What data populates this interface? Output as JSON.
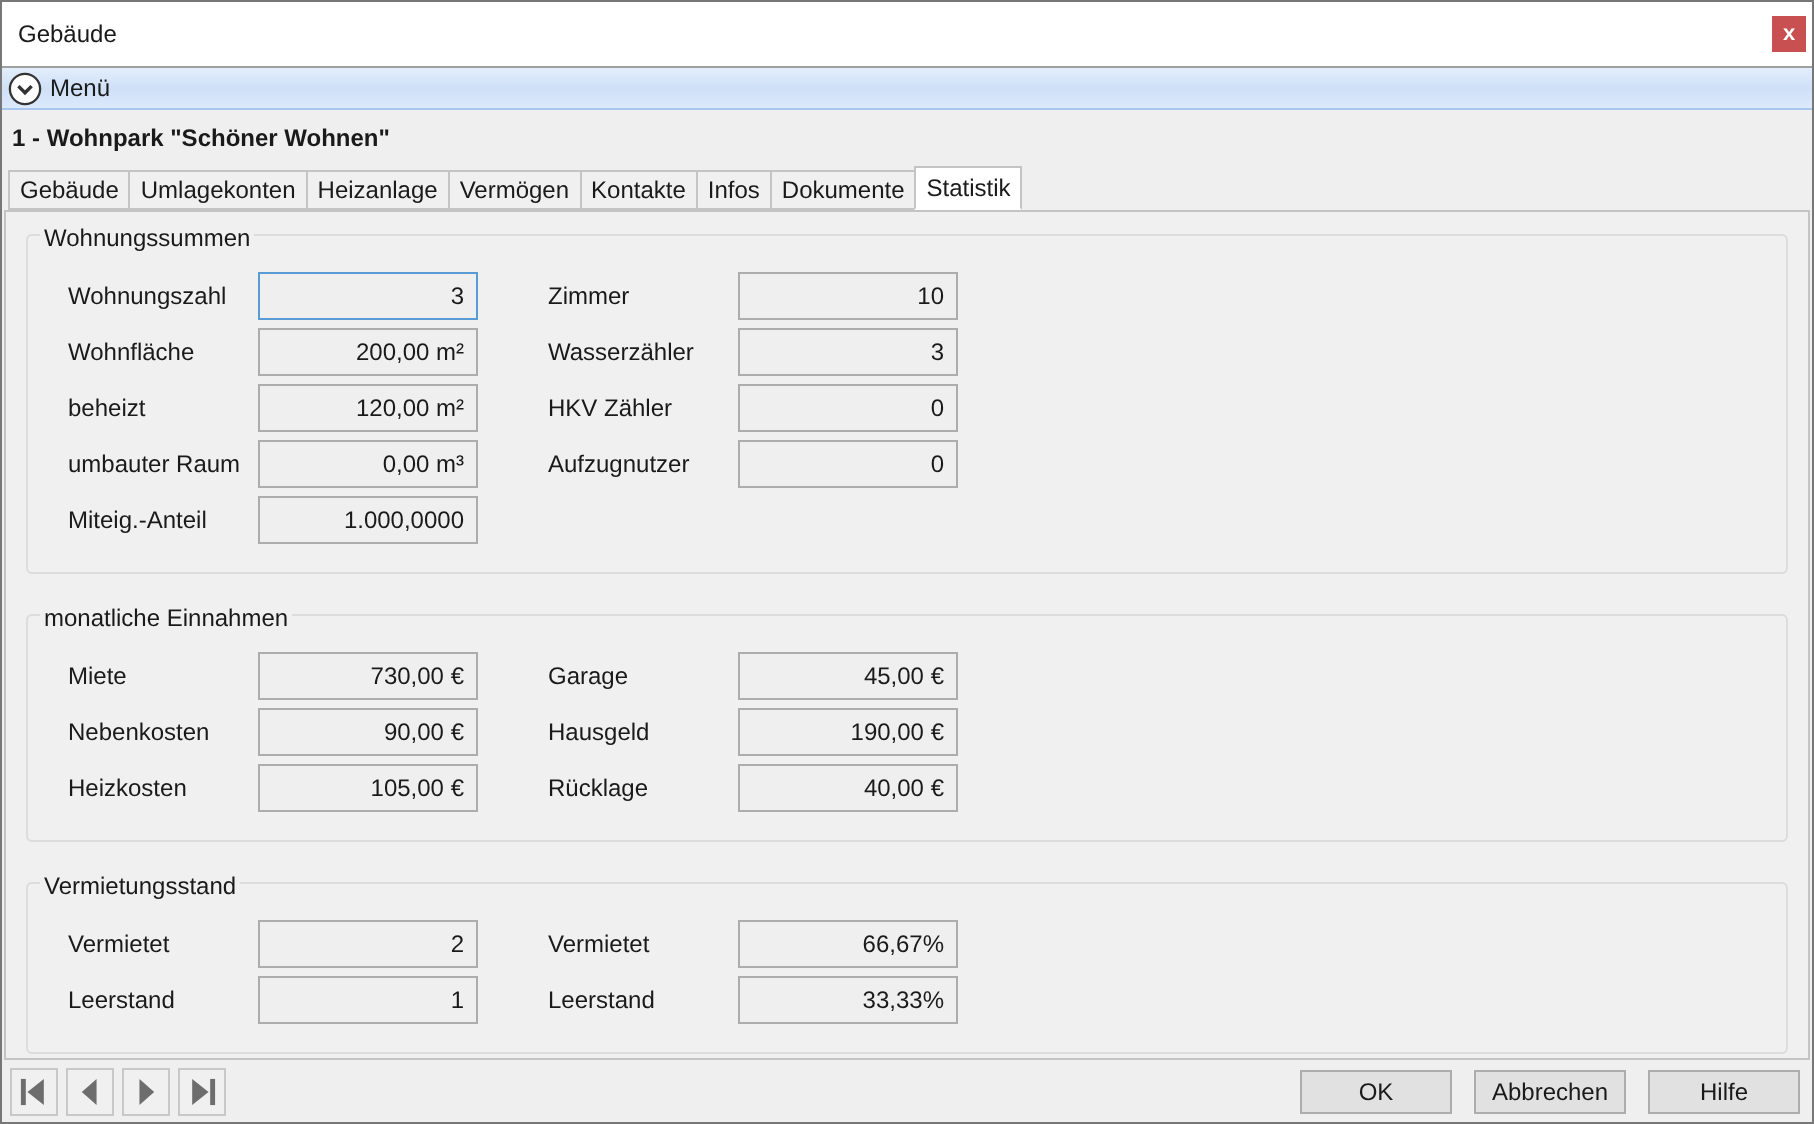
{
  "window": {
    "title": "Gebäude",
    "close": "x"
  },
  "menu": {
    "label": "Menü"
  },
  "heading": "1 - Wohnpark \"Schöner Wohnen\"",
  "tabs": [
    {
      "label": "Gebäude",
      "selected": false
    },
    {
      "label": "Umlagekonten",
      "selected": false
    },
    {
      "label": "Heizanlage",
      "selected": false
    },
    {
      "label": "Vermögen",
      "selected": false
    },
    {
      "label": "Kontakte",
      "selected": false
    },
    {
      "label": "Infos",
      "selected": false
    },
    {
      "label": "Dokumente",
      "selected": false
    },
    {
      "label": "Statistik",
      "selected": true
    }
  ],
  "groups": [
    {
      "title": "Wohnungssummen",
      "left": [
        {
          "label": "Wohnungszahl",
          "value": "3",
          "focused": true
        },
        {
          "label": "Wohnfläche",
          "value": "200,00 m²",
          "focused": false
        },
        {
          "label": "beheizt",
          "value": "120,00 m²",
          "focused": false
        },
        {
          "label": "umbauter Raum",
          "value": "0,00 m³",
          "focused": false
        },
        {
          "label": "Miteig.-Anteil",
          "value": "1.000,0000",
          "focused": false
        }
      ],
      "right": [
        {
          "label": "Zimmer",
          "value": "10",
          "focused": false
        },
        {
          "label": "Wasserzähler",
          "value": "3",
          "focused": false
        },
        {
          "label": "HKV Zähler",
          "value": "0",
          "focused": false
        },
        {
          "label": "Aufzugnutzer",
          "value": "0",
          "focused": false
        }
      ]
    },
    {
      "title": "monatliche Einnahmen",
      "left": [
        {
          "label": "Miete",
          "value": "730,00 €",
          "focused": false
        },
        {
          "label": "Nebenkosten",
          "value": "90,00 €",
          "focused": false
        },
        {
          "label": "Heizkosten",
          "value": "105,00 €",
          "focused": false
        }
      ],
      "right": [
        {
          "label": "Garage",
          "value": "45,00 €",
          "focused": false
        },
        {
          "label": "Hausgeld",
          "value": "190,00 €",
          "focused": false
        },
        {
          "label": "Rücklage",
          "value": "40,00 €",
          "focused": false
        }
      ]
    },
    {
      "title": "Vermietungsstand",
      "left": [
        {
          "label": "Vermietet",
          "value": "2",
          "focused": false
        },
        {
          "label": "Leerstand",
          "value": "1",
          "focused": false
        }
      ],
      "right": [
        {
          "label": "Vermietet",
          "value": "66,67%",
          "focused": false
        },
        {
          "label": "Leerstand",
          "value": "33,33%",
          "focused": false
        }
      ]
    }
  ],
  "buttons": [
    "OK",
    "Abbrechen",
    "Hilfe"
  ]
}
